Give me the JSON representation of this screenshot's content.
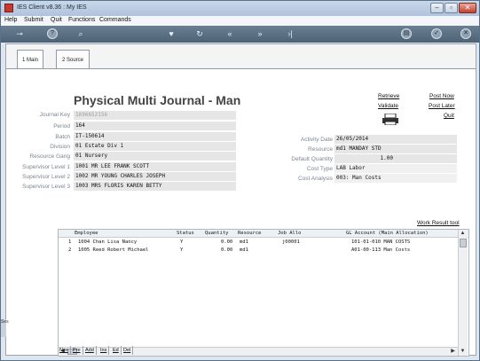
{
  "window": {
    "title": "IES Client v8.36 : My IES"
  },
  "menu": {
    "items": [
      "Help",
      "Submit",
      "Quit",
      "Functions",
      "Commands"
    ]
  },
  "toolbar": {
    "left_icons": [
      "key-icon",
      "help-icon",
      "search-icon"
    ],
    "right_icons": [
      "heart-icon",
      "refresh-icon",
      "rewind-icon",
      "fast-forward-icon",
      "skip-end-icon",
      "print-icon",
      "check-icon",
      "close-icon"
    ]
  },
  "tabs": [
    {
      "label": "1 Main"
    },
    {
      "label": "2 Source"
    }
  ],
  "page": {
    "title": "Physical Multi Journal - Man"
  },
  "actions": {
    "retrieve": "Retrieve",
    "validate": "Validate",
    "post_now": "Post Now",
    "post_later": "Post Later",
    "quit": "Quit"
  },
  "form_left": {
    "journal_key": {
      "label": "Journal Key",
      "value": "1696652156"
    },
    "period": {
      "label": "Period",
      "value": "164"
    },
    "batch": {
      "label": "Batch",
      "value": "IT-150614"
    },
    "division": {
      "label": "Division",
      "value": "01 Estate Div 1"
    },
    "resource_gang": {
      "label": "Resource Gang",
      "value": "01 Nursery"
    },
    "supervisor_1": {
      "label": "Supervisor Level 1",
      "value": "1001 MR LEE FRANK SCOTT"
    },
    "supervisor_2": {
      "label": "Supervisor Level 2",
      "value": "1002 MR YOUNG CHARLES JOSEPH"
    },
    "supervisor_3": {
      "label": "Supervisor Level 3",
      "value": "1003 MRS FLORIS KAREN BETTY"
    }
  },
  "form_right": {
    "activity_date": {
      "label": "Activity Date",
      "value": "26/05/2014"
    },
    "resource": {
      "label": "Resource",
      "value": "md1 MANDAY STD"
    },
    "default_quantity": {
      "label": "Default Quantity",
      "value": "1.00"
    },
    "cost_type": {
      "label": "Cost Type",
      "value": "LAB Labor"
    },
    "cost_analysis": {
      "label": "Cost Analysis",
      "value": "003: Man Costs"
    }
  },
  "grid": {
    "work_result_tool": "Work Result tool",
    "headers": [
      "Employee",
      "Status",
      "Quantity",
      "Resource",
      "Job Allo",
      "GL Account (Main Allocation)"
    ],
    "rows": [
      {
        "n": "1",
        "employee": "1004 Chan Lisa Nancy",
        "status": "Y",
        "quantity": "0.00",
        "resource": "md1",
        "job": "j00001",
        "gl": "101-01-010 MAN COSTS"
      },
      {
        "n": "2",
        "employee": "1005 Reed Robert Michael",
        "status": "Y",
        "quantity": "0.00",
        "resource": "md1",
        "job": "",
        "gl": "A01-00-113 Man Costs"
      }
    ],
    "buttons": [
      "Nex",
      "Pre",
      "Add",
      "Ins",
      "Ed",
      "Del"
    ]
  },
  "side_tab": "Ses"
}
